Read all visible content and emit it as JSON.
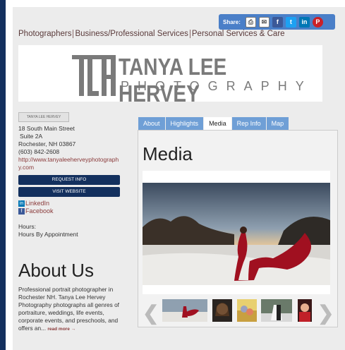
{
  "share": {
    "label": "Share:",
    "icons": [
      "print-icon",
      "email-icon",
      "facebook-icon",
      "twitter-icon",
      "linkedin-icon",
      "pinterest-icon"
    ]
  },
  "categories": [
    "Photographers",
    "Business/Professional Services",
    "Personal Services & Care"
  ],
  "logo": {
    "line1": "TANYA LEE HERVEY",
    "line2": "PHOTOGRAPHY",
    "mark": "TLH"
  },
  "sidebar": {
    "small_logo": "TANYA LEE HERVEY",
    "address": [
      "18 South Main Street",
      "Suite 2A",
      "Rochester, NH 03867",
      "(603) 842-2608"
    ],
    "website_url": "http://www.tanyaleeherveyphotography.com",
    "request_info": "REQUEST INFO",
    "visit_website": "VISIT WEBSITE",
    "linkedin": "LinkedIn",
    "facebook": "Facebook",
    "hours_label": "Hours:",
    "hours_value": "Hours By Appointment"
  },
  "about": {
    "title": "About Us",
    "text": "Professional portrait photographer in Rochester NH. Tanya Lee Hervey Photography photographs all genres of portraiture, weddings, life events, corporate events, and preschools, and offers an...",
    "read_more": "read more →"
  },
  "tabs": [
    "About",
    "Highlights",
    "Media",
    "Rep Info",
    "Map"
  ],
  "active_tab": "Media",
  "media": {
    "title": "Media"
  }
}
